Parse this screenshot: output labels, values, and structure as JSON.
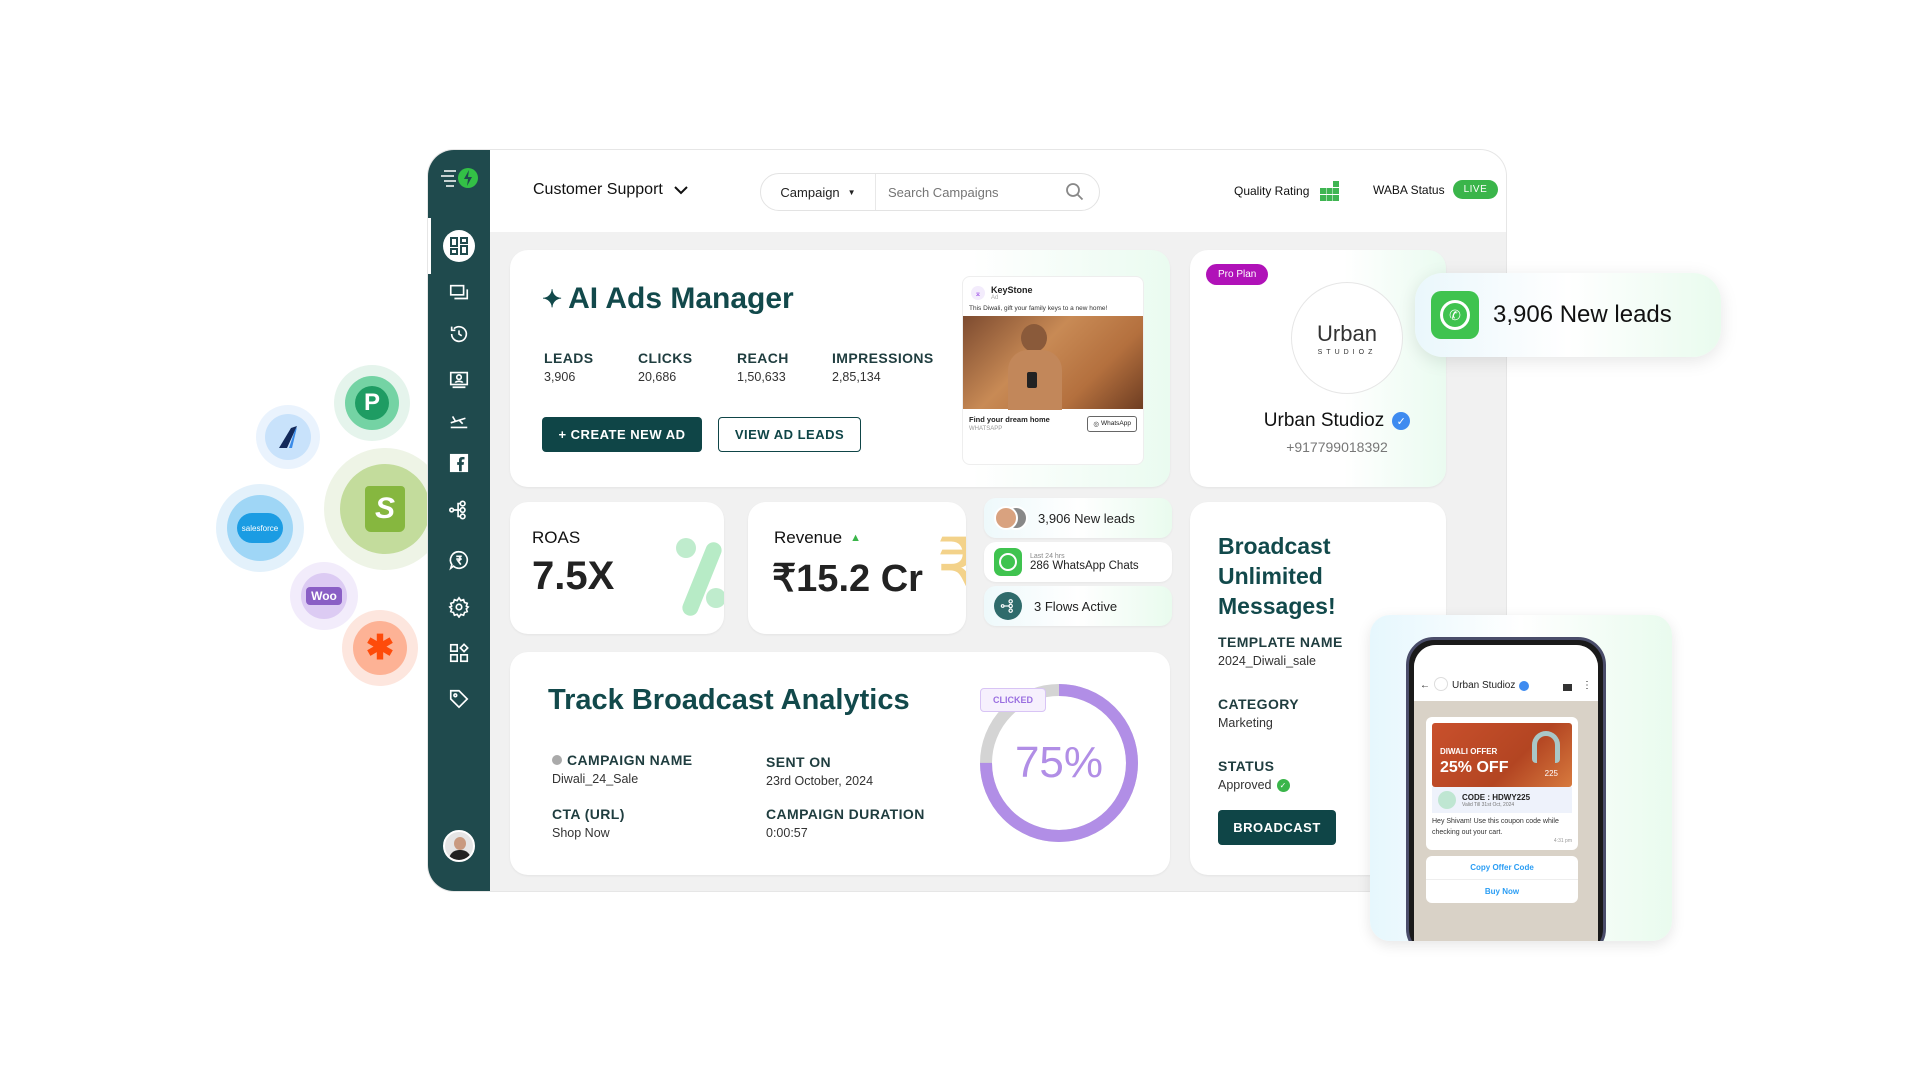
{
  "header": {
    "workspace": "Customer Support",
    "search_filter": "Campaign",
    "search_placeholder": "Search Campaigns",
    "quality_rating_label": "Quality Rating",
    "waba_status_label": "WABA Status",
    "waba_status_value": "LIVE"
  },
  "sidebar": {
    "items": [
      {
        "icon": "dashboard-icon",
        "active": true
      },
      {
        "icon": "chat-icon"
      },
      {
        "icon": "history-icon"
      },
      {
        "icon": "contacts-icon"
      },
      {
        "icon": "campaign-icon"
      },
      {
        "icon": "facebook-icon"
      },
      {
        "icon": "flows-icon"
      },
      {
        "icon": "payments-icon"
      },
      {
        "icon": "settings-icon"
      },
      {
        "icon": "integrations-icon"
      },
      {
        "icon": "tag-icon"
      }
    ]
  },
  "ads": {
    "title": "AI Ads Manager",
    "metrics": [
      {
        "label": "LEADS",
        "value": "3,906"
      },
      {
        "label": "CLICKS",
        "value": "20,686"
      },
      {
        "label": "REACH",
        "value": "1,50,633"
      },
      {
        "label": "IMPRESSIONS",
        "value": "2,85,134"
      }
    ],
    "create_btn": "+ CREATE NEW AD",
    "view_btn": "VIEW AD LEADS",
    "preview": {
      "brand": "KeyStone",
      "sub": "Ad",
      "caption": "This Diwali, gift your family keys to a new home!",
      "headline": "Find your dream home",
      "source": "WHATSAPP",
      "cta": "WhatsApp"
    }
  },
  "profile": {
    "plan": "Pro Plan",
    "logo_main": "Urban",
    "logo_sub": "STUDIOZ",
    "name": "Urban Studioz",
    "phone": "+917799018392"
  },
  "leads_badge": {
    "text": "3,906 New leads"
  },
  "roas": {
    "label": "ROAS",
    "value": "7.5X"
  },
  "revenue": {
    "label": "Revenue",
    "value": "₹15.2 Cr"
  },
  "mini_stats": [
    {
      "text": "3,906 New leads"
    },
    {
      "sub": "Last 24 hrs",
      "text": "286 WhatsApp Chats"
    },
    {
      "text": "3 Flows Active"
    }
  ],
  "analytics": {
    "title": "Track Broadcast Analytics",
    "fields": [
      {
        "label": "CAMPAIGN NAME",
        "value": "Diwali_24_Sale"
      },
      {
        "label": "SENT ON",
        "value": "23rd October, 2024"
      },
      {
        "label": "CTA (URL)",
        "value": "Shop Now"
      },
      {
        "label": "CAMPAIGN DURATION",
        "value": "0:00:57"
      }
    ],
    "clicked_label": "CLICKED",
    "clicked_percent": 75,
    "clicked_text": "75%",
    "ring_color": "#b18ee6"
  },
  "broadcast": {
    "title": "Broadcast Unlimited Messages!",
    "fields": [
      {
        "label": "TEMPLATE NAME",
        "value": "2024_Diwali_sale"
      },
      {
        "label": "CATEGORY",
        "value": "Marketing"
      },
      {
        "label": "STATUS",
        "value": "Approved"
      }
    ],
    "button": "BROADCAST"
  },
  "phone": {
    "contact": "Urban Studioz",
    "offer_small": "DIWALI OFFER",
    "offer_big": "25% OFF",
    "offer_num": "225",
    "code": "CODE : HDWY225",
    "valid": "Valid Till 31st Oct, 2024",
    "message": "Hey Shivam! Use this coupon code while checking out your cart.",
    "time": "4:31 pm",
    "btn1": "Copy Offer Code",
    "btn2": "Buy Now"
  },
  "integrations": [
    {
      "name": "pabbly",
      "label": "P"
    },
    {
      "name": "marketo",
      "label": ""
    },
    {
      "name": "shopify",
      "label": "S"
    },
    {
      "name": "salesforce",
      "label": "salesforce"
    },
    {
      "name": "woocommerce",
      "label": "Woo"
    },
    {
      "name": "zapier",
      "label": "✱"
    }
  ],
  "colors": {
    "brand": "#12494b",
    "accent_green": "#3bb54a",
    "purple": "#b18ee6"
  }
}
